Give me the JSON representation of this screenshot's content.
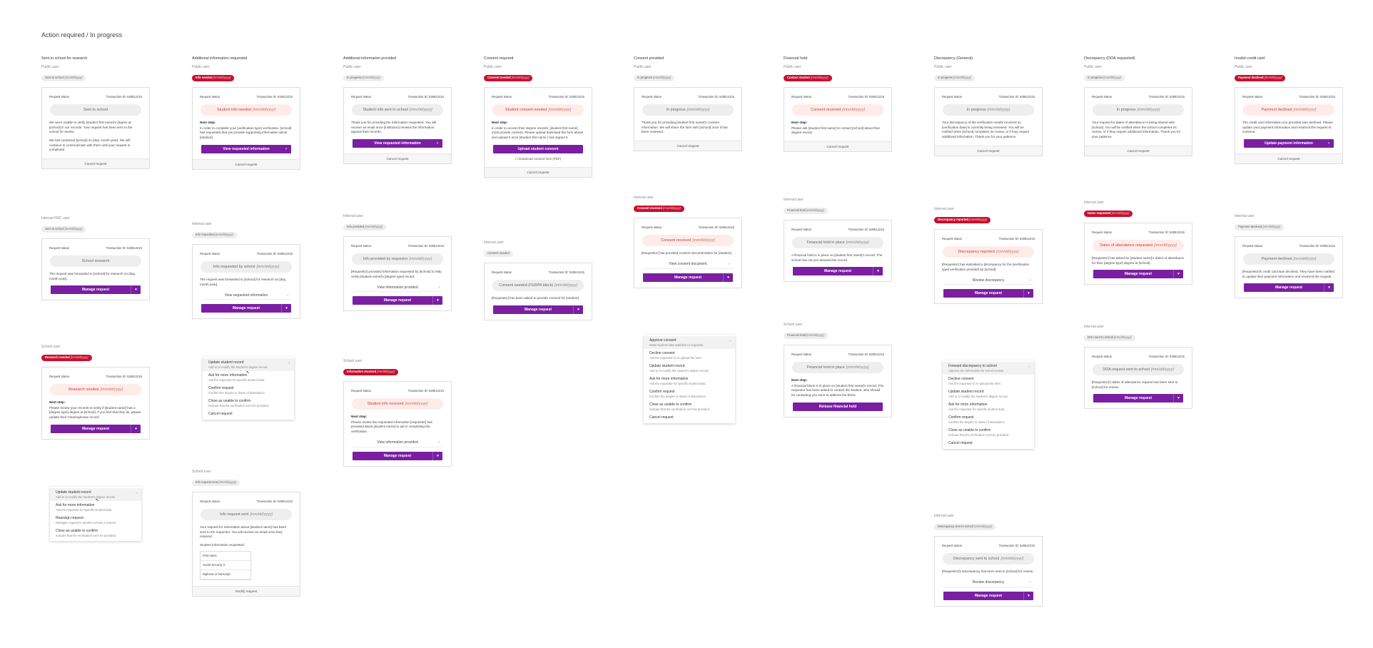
{
  "page_title": "Action required / In progress",
  "labels": {
    "request_status": "Request status",
    "transaction": "Transaction ID: 528512215",
    "next_step": "Next step:",
    "learn_more": "Learn more"
  },
  "columns": [
    {
      "title": "Sent to school for research",
      "public": {
        "user": "Public user",
        "badge": "Sent to school",
        "badge_date": "[mm/dd/yyyy]",
        "pill": "Sent to school",
        "pill_date": "",
        "body1": "We were unable to verify [student first name]'s degree at [school] in our records. Your request has been sent to the school for review.",
        "body2": "We last contacted [school] on [day, month year]. We will continue to communicate with them until your request is completed.",
        "foot": "Cancel request"
      },
      "internal": {
        "user": "Internal NSC user",
        "badge": "Sent to school",
        "badge_date": "[mm/dd/yyyy]",
        "pill": "School research",
        "body": "The request was forwarded to [school] for research on [day, month year].",
        "btn": "Manage request"
      },
      "school": {
        "user": "School user",
        "badge": "Research needed",
        "badge_date": "[mm/dd/yyyy]",
        "pill": "Research needed",
        "pill_date": "[mm/dd/yyyy]",
        "body": "Please review your records to verify if [student name] has a [degree type] degree at [school]. If you find that they do, please update their Clearinghouse record.",
        "btn": "Manage request"
      },
      "menu": [
        {
          "t": "Update student record",
          "d": "Add to or modify the student's degree record."
        },
        {
          "t": "Ask for more information",
          "d": "Ask the requestor for specific student data."
        },
        {
          "t": "Reassign request",
          "d": "Delegate request to another school or branch."
        },
        {
          "t": "Close as unable to confirm",
          "d": "Indicate that the verification can't be provided."
        }
      ]
    },
    {
      "title": "Additional information requested",
      "public": {
        "user": "Public user",
        "badge": "Info needed",
        "badge_date": "[mm/dd/yyyy]",
        "pill": "Student info needed",
        "pill_date": "[mm/dd/yyyy]",
        "body": "In order to complete your [verification type] verification, [school] has requested that you provide supporting information about [student].",
        "btn": "View requested information",
        "foot": "Cancel request"
      },
      "internal": {
        "user": "Internal user",
        "badge": "Info requested",
        "badge_date": "[mm/dd/yyyy]",
        "pill": "Info requested by school",
        "pill_date": "[mm/dd/yyyy]",
        "body": "The request was forwarded to [school] for research on [day, month year].",
        "link": "View requested information",
        "btn": "Manage request"
      },
      "menu": [
        {
          "t": "Update student record",
          "d": "Add to or modify the student's degree record."
        },
        {
          "t": "Ask for more information",
          "d": "Ask the requestor for specific student data."
        },
        {
          "t": "Confirm request",
          "d": "Confirm the degree or dates of attendance."
        },
        {
          "t": "Close as unable to confirm",
          "d": "Indicate that the verification can't be provided."
        },
        {
          "t": "Cancel request",
          "d": ""
        }
      ],
      "school": {
        "user": "School user",
        "badge": "Info request sent",
        "badge_date": "[mm/dd/yyyy]",
        "pill": "Info request sent",
        "pill_date": "[mm/dd/yyyy]",
        "body": "Your request for information about [student name] has been sent to the requestor. You will receive an email once they respond.",
        "sub": "Student information requested:",
        "rows": [
          "First name",
          "Social Security #",
          "Diploma or transcript"
        ],
        "foot": "Modify request"
      }
    },
    {
      "title": "Additional information provided",
      "public": {
        "user": "Public user",
        "badge": "In progress",
        "badge_date": "[mm/dd/yyyy]",
        "pill": "Student info sent to school",
        "pill_date": "[mm/dd/yyyy]",
        "body": "Thank you for providing the information requested. You will receive an email once [institution] reviews the information against their records.",
        "btn": "View requested information",
        "foot": "Cancel request"
      },
      "internal": {
        "user": "Internal user",
        "badge": "Info provided",
        "badge_date": "[mm/dd/yyyy]",
        "pill": "Info provided by requestor",
        "pill_date": "[mm/dd/yyyy]",
        "body": "[Requestor] provided information requested by [school] to help verify [student name]'s [degree type] record.",
        "link": "View information provided",
        "btn": "Manage request"
      },
      "school": {
        "user": "School user",
        "badge": "Information received",
        "badge_date": "[mm/dd/yyyy]",
        "pill": "Student info received",
        "pill_date": "[mm/dd/yyyy]",
        "body": "Please review the requested information [requestor] has provided about [student name] to aid in completing the verification.",
        "link": "View information provided",
        "btn": "Manage request"
      }
    },
    {
      "title": "Consent required",
      "public": {
        "user": "Public user",
        "badge": "Consent needed",
        "badge_date": "[mm/dd/yyyy]",
        "pill": "Student consent needed",
        "pill_date": "[mm/dd/yyyy]",
        "body": "In order to access their degree records, [student first name] must provide consent. Please upload download the form above and upload it once [student first name ] has signed it.",
        "btn": "Upload student consent",
        "check": "Download consent form (PDF)",
        "foot": "Cancel request"
      },
      "internal": {
        "user": "Internal user",
        "badge": "Consent needed",
        "badge_date": "",
        "pill": "Consent needed (FERPA block)",
        "pill_date": "[mm/dd/yyyy]",
        "body": "[Requestor] has been asked to provide consent for [student].",
        "btn": "Manage request"
      }
    },
    {
      "title": "Consent provided",
      "public": {
        "user": "Public user",
        "badge": "In progress",
        "badge_date": "[mm/dd/yyyy]",
        "pill": "In progress",
        "pill_date": "[mm/dd/yyyy]",
        "body": "Thank you for providing [student first name]'s consent information. We will share the form with [school] once it has been reviewed.",
        "foot": "Cancel request"
      },
      "internal": {
        "user": "Internal user",
        "badge": "Consent received",
        "badge_date": "[mm/dd/yyyy]",
        "pill": "Consent received",
        "pill_date": "[mm/dd/yyyy]",
        "body": "[Requestor] has provided consent documentation for [student].",
        "link": "View consent document",
        "btn": "Manage request"
      },
      "menu": [
        {
          "t": "Approve consent",
          "d": "Make student data available to requestor."
        },
        {
          "t": "Decline consent",
          "d": "Ask the requestor to re-upload the form."
        },
        {
          "t": "Update student record",
          "d": "Add to or modify the student's degree record."
        },
        {
          "t": "Ask for more information",
          "d": "Ask the requestor for specific student data."
        },
        {
          "t": "Confirm request",
          "d": "Confirm the degree or dates of attendance."
        },
        {
          "t": "Close as unable to confirm",
          "d": "Indicate that the verification can't be provided."
        },
        {
          "t": "Cancel request",
          "d": ""
        }
      ]
    },
    {
      "title": "Financial hold",
      "public": {
        "user": "Public user",
        "badge": "Contact student",
        "badge_date": "[mm/dd/yyyy]",
        "pill": "Consent received",
        "pill_date": "[mm/dd/yyyy]",
        "body": "Please ask [student first name] to contact [school] about their degree record.",
        "foot": "Cancel request"
      },
      "internal": {
        "user": "Internal user",
        "badge": "Financial hold",
        "badge_date": "[mm/dd/yyyy]",
        "pill": "Financial hold in place",
        "pill_date": "[mm/dd/yyyy]",
        "body": "A financial hold is in place on [student first name]'s record. The school has not yet released the record.",
        "btn": "Manage request"
      },
      "school": {
        "user": "School user",
        "badge": "Financial hold",
        "badge_date": "[mm/dd/yyyy]",
        "pill": "Financial hold in place",
        "pill_date": "[mm/dd/yyyy]",
        "body": "A financial block is in place on [student first name]'s record. The requestor has been asked to contact the student, who should be contacting you soon to address the block.",
        "btn": "Release financial hold"
      }
    },
    {
      "title": "Discrepancy (General)",
      "public": {
        "user": "Public user",
        "badge": "In progress",
        "badge_date": "[mm/dd/yyyy]",
        "pill": "In progress",
        "pill_date": "[mm/dd/yyyy]",
        "body": "Your discrepancy of the verification results received on [verification date] is currently being reviewed. You will be notified when [school] completes its review, or if they require additional information. Thank you for your patience.",
        "foot": "Cancel request"
      },
      "internal": {
        "user": "Internal user",
        "badge": "Discrepancy reported",
        "badge_date": "[mm/dd/yyyy]",
        "pill": "Discrepancy reported",
        "pill_date": "[mm/dd/yyyy]",
        "body": "[Requestor] has submitted a discrepancy for the [verification type] verification provided by [school].",
        "link": "Review discrepancy",
        "btn": "Manage request"
      },
      "menu": [
        {
          "t": "Forward discrepancy to school",
          "d": "Approve the information for school review."
        },
        {
          "t": "Decline consent",
          "d": "Ask the requestor to re-upload the form."
        },
        {
          "t": "Update student record",
          "d": "Add to or modify the student's degree record."
        },
        {
          "t": "Ask for more information",
          "d": "Ask the requestor for specific student data."
        },
        {
          "t": "Confirm request",
          "d": "Confirm the degree or dates of attendance."
        },
        {
          "t": "Close as unable to confirm",
          "d": "Indicate that the verification can't be provided."
        },
        {
          "t": "Cancel request",
          "d": ""
        }
      ],
      "internal2": {
        "user": "Internal user",
        "badge": "Discrepancy sent to school",
        "badge_date": "[mm/dd/yyyy]",
        "pill": "Discrepancy sent to school",
        "pill_date": "[mm/dd/yyyy]",
        "body": "[Requestor]'s Discrepancy has been sent to [school] for review.",
        "link": "Review discrepancy",
        "btn": "Manage request"
      }
    },
    {
      "title": "Discrepancy (DOA requested)",
      "public": {
        "user": "Public user",
        "badge": "In progress",
        "badge_date": "[mm/dd/yyyy]",
        "pill": "In progress",
        "pill_date": "[mm/dd/yyyy]",
        "body": "Your request for dates of attendance is being shared with [school]. You will be notified when the school completes its review, or if they require additional information. Thank you for your patience.",
        "foot": "Cancel request"
      },
      "internal": {
        "user": "Internal user",
        "badge": "Dates requested",
        "badge_date": "[mm/dd/yyyy]",
        "pill": "Dates of attendance requested",
        "pill_date": "[mm/dd/yyyy]",
        "body": "[Requestor] has asked for [student name]'s dates of attendance for their [degree type] degree at [school].",
        "btn": "Manage request"
      },
      "internal2": {
        "user": "Internal user",
        "badge": "DOA sent to school",
        "badge_date": "[mm/dd/yyyy]",
        "pill": "DOA request sent to school",
        "pill_date": "[mm/dd/yyyy]",
        "body": "[Requestor]'s dates of attendance request has been sent to [school] for review.",
        "btn": "Manage request"
      }
    },
    {
      "title": "Invalid credit card",
      "public": {
        "user": "Public user",
        "badge": "Payment declined",
        "badge_date": "[mm/dd/yyyy]",
        "pill": "Payment declined",
        "pill_date": "[mm/dd/yyyy]",
        "body": "The credit card information you provided was declined. Please update your payment information and resubmit the request to continue.",
        "btn": "Update payment information",
        "foot": "Cancel request"
      },
      "internal": {
        "user": "Internal user",
        "badge": "Payment declined",
        "badge_date": "[mm/dd/yyyy]",
        "pill": "Payment declined",
        "pill_date": "[mm/dd/yyyy]",
        "body": "[Requestor]'s credit card was declined. They have been notified to update their payment information and resubmit the request.",
        "btn": "Manage request"
      }
    }
  ]
}
